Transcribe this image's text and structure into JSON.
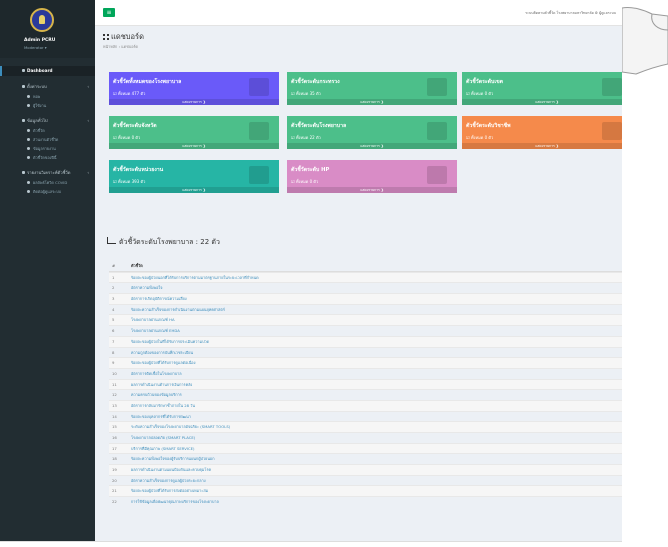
{
  "sidebar": {
    "user_name": "Admin PCRU",
    "user_role": "Moderator ▾",
    "menu": [
      {
        "label": "Dashboard",
        "type": "active"
      },
      {
        "label": "ตั้งค่าระบบ",
        "type": "group",
        "arrow": "‹"
      },
      {
        "label": "หอพ",
        "type": "sub"
      },
      {
        "label": "ผู้ใช้งาน",
        "type": "sub"
      },
      {
        "label": "ข้อมูลทั่วไป",
        "type": "group",
        "arrow": "‹"
      },
      {
        "label": "ตัวชี้วัด",
        "type": "sub"
      },
      {
        "label": "ส่วนงานตัวชี้วัด",
        "type": "sub"
      },
      {
        "label": "ข้อมูลรายงาน",
        "type": "sub"
      },
      {
        "label": "ตัวชี้วัดของปีนี้",
        "type": "sub"
      },
      {
        "label": "รายงานวิเคราะห์ตัวชี้วัด",
        "type": "group",
        "arrow": "‹"
      },
      {
        "label": "ผลลัพธ์โควิด COVID",
        "type": "sub"
      },
      {
        "label": "ติดต่อผู้ดูแลระบบ",
        "type": "sub"
      }
    ]
  },
  "topbar": {
    "menu_icon": "≡",
    "user": "ระบบติดตามตัวชี้วัด โรงพยาบาลมหาวิทยาลัย   ⚙ ผู้ดูแลระบบ"
  },
  "page": {
    "title": "แดชบอร์ด",
    "breadcrumb": "หน้าหลัก  ›  แดชบอร์ด"
  },
  "boxes": [
    {
      "title": "ตัวชี้วัดทั้งหมดของโรงพยาบาล",
      "count": "☑ ทั้งหมด 477 ตัว",
      "footer": "แสดงรายการ ❯",
      "color": "#6a5af9"
    },
    {
      "title": "ตัวชี้วัดระดับกระทรวง",
      "count": "☑ ทั้งหมด 35 ตัว",
      "footer": "แสดงรายการ ❯",
      "color": "#4cbf8a"
    },
    {
      "title": "ตัวชี้วัดระดับเขต",
      "count": "☑ ทั้งหมด 0 ตัว",
      "footer": "แสดงรายการ ❯",
      "color": "#4cbf8a"
    },
    {
      "title": "ตัวชี้วัดระดับจังหวัด",
      "count": "☑ ทั้งหมด 0 ตัว",
      "footer": "แสดงรายการ ❯",
      "color": "#4cbf8a"
    },
    {
      "title": "ตัวชี้วัดระดับโรงพยาบาล",
      "count": "☑ ทั้งหมด 22 ตัว",
      "footer": "แสดงรายการ ❯",
      "color": "#4cbf8a"
    },
    {
      "title": "ตัวชี้วัดระดับวิชาชีพ",
      "count": "☑ ทั้งหมด 0 ตัว",
      "footer": "แสดงรายการ ❯",
      "color": "#f58a4b"
    },
    {
      "title": "ตัวชี้วัดระดับหน่วยงาน",
      "count": "☑ ทั้งหมด 393 ตัว",
      "footer": "แสดงรายการ ❯",
      "color": "#26b5a5"
    },
    {
      "title": "ตัวชี้วัดระดับ HP",
      "count": "☑ ทั้งหมด 0 ตัว",
      "footer": "แสดงรายการ ❯",
      "color": "#d98cc6"
    }
  ],
  "section": {
    "title": "ตัวชี้วัดระดับโรงพยาบาล : 22 ตัว"
  },
  "table": {
    "headers": [
      "#",
      "ตัวชี้วัด"
    ],
    "rows": [
      [
        "1",
        "ร้อยละของผู้ป่วยนอกที่ได้รับการบริการตามมาตรฐานภายในระยะเวลาที่กำหนด"
      ],
      [
        "2",
        "อัตราความพึงพอใจ"
      ],
      [
        "3",
        "อัตราการเกิดอุบัติการณ์ความเสี่ยง"
      ],
      [
        "4",
        "ร้อยละความสำเร็จของการดำเนินงานตามแผนยุทธศาสตร์"
      ],
      [
        "5",
        "โรงพยาบาลผ่านเกณฑ์ HA"
      ],
      [
        "6",
        "โรงพยาบาลผ่านเกณฑ์ EHDA"
      ],
      [
        "7",
        "ร้อยละของผู้ป่วยในที่ได้รับการประเมินความปวด"
      ],
      [
        "8",
        "ความถูกต้องของการบันทึกเวชระเบียน"
      ],
      [
        "9",
        "ร้อยละของผู้ป่วยที่ได้รับการดูแลต่อเนื่อง"
      ],
      [
        "10",
        "อัตราการติดเชื้อในโรงพยาบาล"
      ],
      [
        "11",
        "ผลการดำเนินงานด้านการเงินการคลัง"
      ],
      [
        "12",
        "ความครบถ้วนของข้อมูลบริการ"
      ],
      [
        "13",
        "อัตราการกลับมารักษาซ้ำภายใน 28 วัน"
      ],
      [
        "14",
        "ร้อยละของบุคลากรที่ได้รับการพัฒนา"
      ],
      [
        "15",
        "ระดับความสำเร็จของโรงพยาบาลอัจฉริยะ (SMART TOOLS)"
      ],
      [
        "16",
        "โรงพยาบาลปลอดภัย (SMART PLACE)"
      ],
      [
        "17",
        "บริการที่มีคุณภาพ (SMART SERVICE)"
      ],
      [
        "18",
        "ร้อยละความพึงพอใจของผู้รับบริการแผนกผู้ป่วยนอก"
      ],
      [
        "19",
        "ผลการดำเนินงานตามแผนป้องกันและควบคุมโรค"
      ],
      [
        "20",
        "อัตราความสำเร็จของการดูแลผู้ป่วยระยะกลาง"
      ],
      [
        "21",
        "ร้อยละของผู้ป่วยที่ได้รับการส่งต่ออย่างเหมาะสม"
      ],
      [
        "22",
        "การใช้ข้อมูลเพื่อพัฒนาคุณภาพบริการของโรงพยาบาล"
      ]
    ]
  }
}
